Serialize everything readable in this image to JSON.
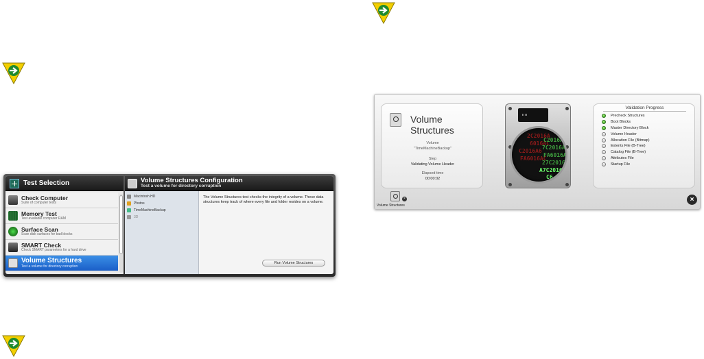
{
  "accent": "#2a6fd6",
  "marker_color": "#f6d200",
  "icons": [
    "arrow-right-icon",
    "plus-icon",
    "magnifier-icon",
    "hard-disk-icon",
    "close-icon"
  ],
  "test_selection": {
    "title": "Test Selection",
    "items": [
      {
        "name": "Check Computer",
        "desc": "Suite of computer tests",
        "selected": false
      },
      {
        "name": "Memory Test",
        "desc": "Test available computer RAM",
        "selected": false
      },
      {
        "name": "Surface Scan",
        "desc": "Scan disk surfaces for bad blocks",
        "selected": false
      },
      {
        "name": "SMART Check",
        "desc": "Check SMART parameters for a hard drive",
        "selected": false
      },
      {
        "name": "Volume Structures",
        "desc": "Test a volume for directory corruption",
        "selected": true
      }
    ]
  },
  "config": {
    "title": "Volume Structures Configuration",
    "subtitle": "Test a volume for directory corruption",
    "volumes": [
      "Macintosh HD",
      "Photos",
      "TimeMachineBackup",
      "3D"
    ],
    "description": "The Volume Structures test checks the integrity of a volume. These data structures keep track of where every file and folder resides on a volume.",
    "run_button": "Run Volume Structures"
  },
  "progress_window": {
    "title": "Volume Structures",
    "volume_label": "Volume",
    "volume_value": "\"TimeMachineBackup\"",
    "step_label": "Step",
    "step_value": "Validating Volume Header",
    "elapsed_label": "Elapsed time",
    "elapsed_value": "00:00:02",
    "validation_title": "Validation Progress",
    "validation_items": [
      {
        "label": "Precheck Structures",
        "done": true
      },
      {
        "label": "Boot Blocks",
        "done": true
      },
      {
        "label": "Master Directory Block",
        "done": true
      },
      {
        "label": "Volume Header",
        "done": false
      },
      {
        "label": "Allocation File (Bitmap)",
        "done": false
      },
      {
        "label": "Extents File (B-Tree)",
        "done": false
      },
      {
        "label": "Catalog File (B-Tree)",
        "done": false
      },
      {
        "label": "Attributes File",
        "done": false
      },
      {
        "label": "Startup File",
        "done": false
      }
    ],
    "disk_hex_red": [
      "2C2016A",
      "6016AC",
      "C2016A6",
      "FA6016AC"
    ],
    "disk_hex_green": [
      "C2016AC",
      "7C2016AC",
      "FA6016A",
      "27C2016",
      "A7C2016",
      "C6"
    ],
    "toolbar_label": "Volume Structures"
  }
}
